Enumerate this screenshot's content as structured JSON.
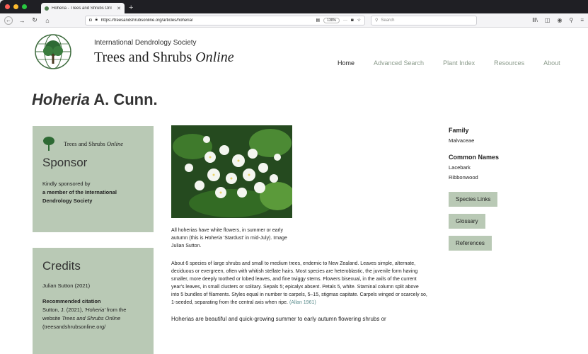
{
  "browser": {
    "tab_title": "Hoheria - Trees and Shrubs Onl",
    "tab_close": "✕",
    "new_tab": "+",
    "url": "https://treesandshrubsonline.org/articles/hoheria/",
    "zoom": "130%",
    "search_placeholder": "Search",
    "more_icon": "···"
  },
  "header": {
    "org_name": "International Dendrology Society",
    "title_main": "Trees and Shrubs ",
    "title_italic": "Online"
  },
  "nav": {
    "items": [
      "Home",
      "Advanced Search",
      "Plant Index",
      "Resources",
      "About"
    ],
    "active": "Home"
  },
  "page": {
    "title_italic": "Hoheria",
    "title_rest": " A. Cunn."
  },
  "sponsor": {
    "brand_main": "Trees and Shrubs ",
    "brand_italic": "Online",
    "heading": "Sponsor",
    "line1": "Kindly sponsored by",
    "line2": "a member of the International Dendrology Society"
  },
  "credits": {
    "heading": "Credits",
    "author": "Julian Sutton (2021)",
    "cite_label": "Recommended citation",
    "cite_text_1": "Sutton, J. (2021), ",
    "cite_text_italic": "'Hoheria'",
    "cite_text_2": " from the website ",
    "cite_site": "Trees and Shrubs Online",
    "cite_domain": "(treesandshrubsonline.org/"
  },
  "article": {
    "caption_1": "All hoherias have white flowers, in summer or early autumn (this is ",
    "caption_italic": "Hoheria",
    "caption_2": " 'Stardust' in mid-July). Image Julian Sutton.",
    "description": "About 6 species of large shrubs and small to medium trees, endemic to New Zealand. Leaves simple, alternate, deciduous or evergreen, often with whitish stellate hairs. Most species are heteroblastic, the juvenile form having smaller, more deeply toothed or lobed leaves, and fine twiggy stems. Flowers bisexual, in the axils of the current year's leaves, in small clusters or solitary. Sepals 5; epicalyx absent. Petals 5, white. Staminal column split above into 5 bundles of filaments. Styles equal in number to carpels, 5–15, stigmas capitate. Carpels winged or scarcely so, 1-seeded, separating from the central axis when ripe. ",
    "description_ref": "(Allan 1961)",
    "description2": "Hoherias are beautiful and quick-growing summer to early autumn flowering shrubs or"
  },
  "info": {
    "family_label": "Family",
    "family_value": "Malvaceae",
    "common_label": "Common Names",
    "common_1": "Lacebark",
    "common_2": "Ribbonwood",
    "btn_species": "Species Links",
    "btn_glossary": "Glossary",
    "btn_references": "References"
  }
}
